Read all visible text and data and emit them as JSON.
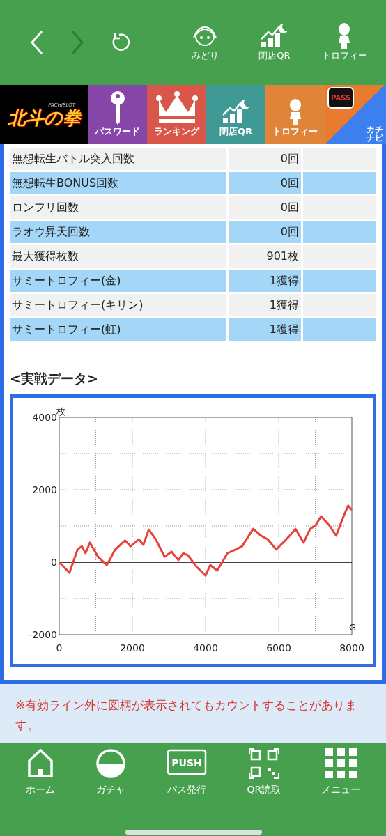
{
  "top_bar": {
    "nav_buttons": [
      {
        "kind": "back",
        "disabled": false
      },
      {
        "kind": "forward",
        "disabled": true
      },
      {
        "kind": "reload",
        "disabled": false
      }
    ],
    "shortcuts": [
      {
        "kind": "character",
        "label": "みどり"
      },
      {
        "kind": "chart",
        "label": "閉店QR"
      },
      {
        "kind": "alien",
        "label": "トロフィー"
      }
    ]
  },
  "banner": {
    "logo": {
      "title": "北斗の拳",
      "subtitle": "PACHISLOT"
    },
    "tiles": [
      {
        "kind": "key",
        "label": "パスワード",
        "color": "#8646a8"
      },
      {
        "kind": "crown",
        "label": "ランキング",
        "color": "#d9574a"
      },
      {
        "kind": "chart",
        "label": "閉店QR",
        "color": "#3f9994"
      },
      {
        "kind": "alien",
        "label": "トロフィー",
        "color": "#e0843a"
      }
    ],
    "app_tile": {
      "badge": "PASS",
      "name": "カチナビ"
    }
  },
  "stats": [
    {
      "label": "無想転生バトル突入回数",
      "value": "0回"
    },
    {
      "label": "無想転生BONUS回数",
      "value": "0回"
    },
    {
      "label": "ロンフリ回数",
      "value": "0回"
    },
    {
      "label": "ラオウ昇天回数",
      "value": "0回"
    },
    {
      "label": "最大獲得枚数",
      "value": "901枚"
    },
    {
      "label": "サミートロフィー(金)",
      "value": "1獲得"
    },
    {
      "label": "サミートロフィー(キリン)",
      "value": "1獲得"
    },
    {
      "label": "サミートロフィー(虹)",
      "value": "1獲得"
    }
  ],
  "section_title": "<実戦データ>",
  "chart": {
    "chart_data": {
      "type": "line",
      "grid": true,
      "xlabel": "G",
      "ylabel": "枚",
      "xlim": [
        0,
        8000
      ],
      "ylim": [
        -2000,
        4000
      ],
      "xticks": [
        0,
        2000,
        4000,
        6000,
        8000
      ],
      "yticks": [
        -2000,
        0,
        2000,
        4000
      ],
      "x": [
        0,
        280,
        500,
        620,
        720,
        840,
        1060,
        1300,
        1530,
        1800,
        1950,
        2180,
        2300,
        2450,
        2640,
        2880,
        3070,
        3260,
        3390,
        3520,
        3760,
        4000,
        4130,
        4320,
        4600,
        4820,
        5000,
        5300,
        5520,
        5700,
        5930,
        6120,
        6300,
        6460,
        6680,
        6860,
        7010,
        7160,
        7380,
        7570,
        7790,
        7900,
        8000
      ],
      "series": [
        {
          "color": "#e8413c",
          "values": [
            0,
            -290,
            350,
            440,
            250,
            540,
            150,
            -80,
            350,
            600,
            440,
            630,
            480,
            900,
            630,
            150,
            290,
            60,
            250,
            190,
            -130,
            -370,
            -80,
            -230,
            250,
            350,
            440,
            920,
            730,
            630,
            350,
            540,
            730,
            920,
            540,
            920,
            1020,
            1270,
            1020,
            730,
            1310,
            1560,
            1440
          ]
        }
      ]
    }
  },
  "note": "※有効ライン外に図柄が表示されてもカウントすることがあります。",
  "bottom_nav": [
    {
      "kind": "home",
      "label": "ホーム"
    },
    {
      "kind": "gacha",
      "label": "ガチャ"
    },
    {
      "kind": "push",
      "label": "パス発行",
      "icon_text": "PUSH"
    },
    {
      "kind": "qr",
      "label": "QR読取"
    },
    {
      "kind": "grid",
      "label": "メニュー"
    }
  ]
}
